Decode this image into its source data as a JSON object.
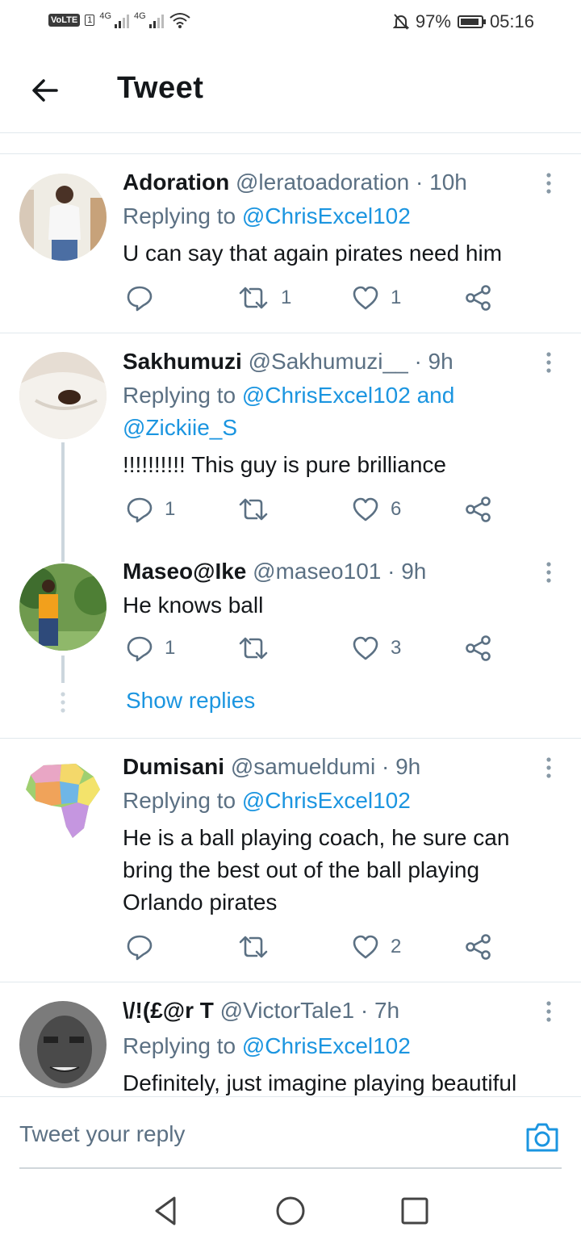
{
  "status_bar": {
    "volte": "VoLTE",
    "sim": "1",
    "net1": "4G",
    "net2": "4G",
    "battery_pct": "97%",
    "time": "05:16"
  },
  "header": {
    "title": "Tweet"
  },
  "tweets": [
    {
      "name": "Adoration",
      "handle": "@leratoadoration",
      "time": "· 10h",
      "replying_prefix": "Replying to",
      "replying_to": "@ChrisExcel102",
      "text": "U can say that again pirates need him",
      "reply_count": "",
      "retweet_count": "1",
      "like_count": "1"
    },
    {
      "name": "Sakhumuzi",
      "handle": "@Sakhumuzi__",
      "time": "· 9h",
      "replying_prefix": "Replying to",
      "replying_to": "@ChrisExcel102 and @Zickiie_S",
      "text": "!!!!!!!!!! This guy is pure brilliance",
      "reply_count": "1",
      "retweet_count": "",
      "like_count": "6"
    },
    {
      "name": "Maseo@Ike",
      "handle": "@maseo101",
      "time": "· 9h",
      "text": "He knows ball",
      "reply_count": "1",
      "retweet_count": "",
      "like_count": "3"
    },
    {
      "name": "Dumisani",
      "handle": "@samueldumi",
      "time": "· 9h",
      "replying_prefix": "Replying to",
      "replying_to": "@ChrisExcel102",
      "text": "He is a ball playing coach, he sure can bring the best out of the ball playing Orlando pirates",
      "reply_count": "",
      "retweet_count": "",
      "like_count": "2"
    },
    {
      "name": "\\/!(£@r T",
      "handle": "@VictorTale1",
      "time": "· 7h",
      "replying_prefix": "Replying to",
      "replying_to": "@ChrisExcel102",
      "text": "Definitely, just imagine playing beautiful"
    }
  ],
  "show_replies": "Show replies",
  "reply_bar": {
    "placeholder": "Tweet your reply"
  },
  "colors": {
    "link": "#1b95e0",
    "muted": "#5b7083",
    "divider": "#e1e8ed"
  },
  "icons": [
    "back-arrow-icon",
    "more-icon",
    "reply-icon",
    "retweet-icon",
    "like-icon",
    "share-icon",
    "camera-icon",
    "nav-back-icon",
    "nav-home-icon",
    "nav-recents-icon"
  ]
}
